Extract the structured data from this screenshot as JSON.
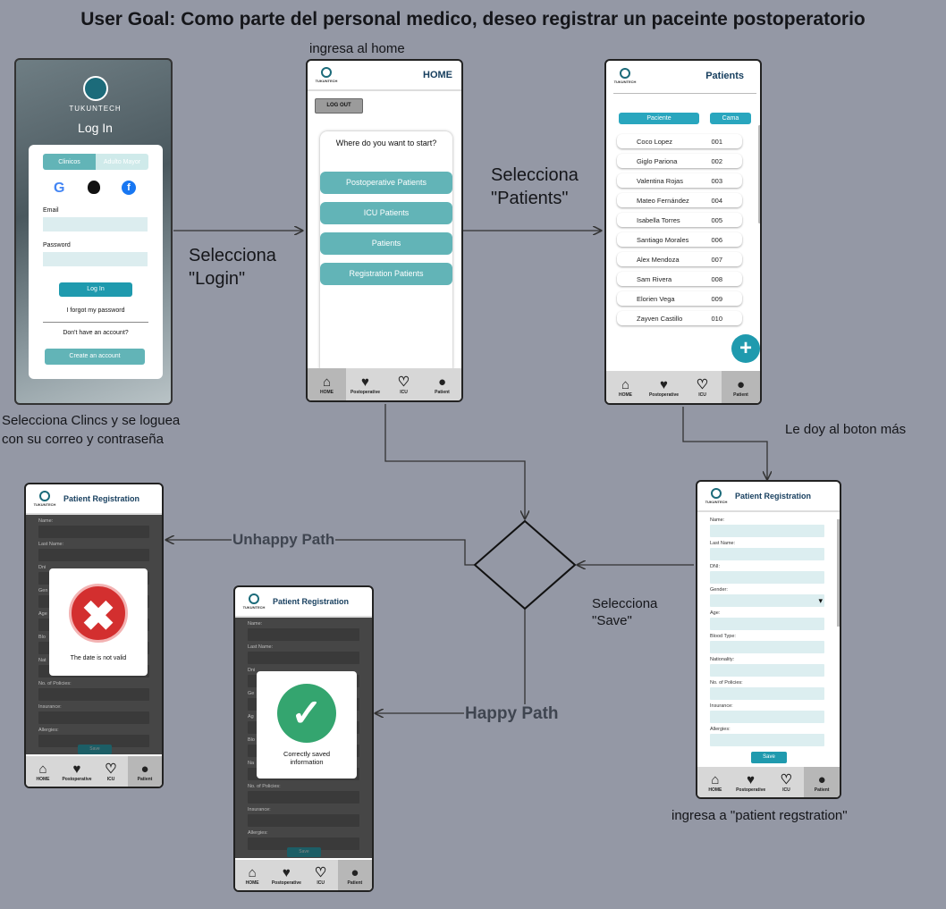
{
  "title": "User Goal: Como parte del personal medico, deseo registrar un paceinte postoperatorio",
  "captions": {
    "home_enter": "ingresa al home",
    "login_step": [
      "Selecciona Clincs y se loguea",
      "con su correo y contraseña"
    ],
    "select_login": [
      "Selecciona",
      "\"Login\""
    ],
    "select_patients": [
      "Selecciona",
      "\"Patients\""
    ],
    "plus_button": "Le doy al boton más",
    "select_save": [
      "Selecciona",
      "\"Save\""
    ],
    "unhappy": "Unhappy Path",
    "happy": "Happy Path",
    "enter_registration": "ingresa a \"patient regstration\""
  },
  "login": {
    "brand": "TUKUNTECH",
    "heading": "Log In",
    "tab_clinics": "Clinicos",
    "tab_elder": "Adulto Mayor",
    "email_label": "Email",
    "password_label": "Password",
    "login_button": "Log In",
    "forgot": "I forgot my password",
    "no_account": "Don't have an account?",
    "create": "Create an account"
  },
  "home": {
    "title": "HOME",
    "brand": "TUKUNTECH",
    "logout": "LOG OUT",
    "prompt": "Where do you want to start?",
    "options": [
      "Postoperative Patients",
      "ICU Patients",
      "Patients",
      "Registration Patients"
    ]
  },
  "patients": {
    "title": "Patients",
    "brand": "TUKUNTECH",
    "col_patient": "Paciente",
    "col_bed": "Cama",
    "rows": [
      [
        "Coco Lopez",
        "001"
      ],
      [
        "Giglo Pariona",
        "002"
      ],
      [
        "Valentina Rojas",
        "003"
      ],
      [
        "Mateo Fernández",
        "004"
      ],
      [
        "Isabella Torres",
        "005"
      ],
      [
        "Santiago Morales",
        "006"
      ],
      [
        "Alex Mendoza",
        "007"
      ],
      [
        "Sam Rivera",
        "008"
      ],
      [
        "Elorien Vega",
        "009"
      ],
      [
        "Zayven Castillo",
        "010"
      ]
    ],
    "add": "+"
  },
  "nav": {
    "home": "HOME",
    "postop": "Postoperative",
    "icu": "ICU",
    "patient": "Patient"
  },
  "registration": {
    "title": "Patient Registration",
    "brand": "TUKUNTECH",
    "fields": [
      "Name:",
      "Last Name:",
      "DNI:",
      "Gender:",
      "Age:",
      "Blood Type:",
      "Nationality:",
      "No. of Policies:",
      "Insurance:",
      "Allergies:"
    ],
    "save": "Save"
  },
  "error": {
    "message": "The date is not valid",
    "left_fields": [
      "Name:",
      "Last Name:",
      "Dni",
      "Gen",
      "Age",
      "Blo",
      "Nat",
      "No. of Policies:",
      "Insurance:",
      "Allergies:"
    ]
  },
  "success": {
    "line1": "Correctly saved",
    "line2": "information",
    "left_fields": [
      "Name:",
      "Last Name:",
      "Dni",
      "Ge",
      "Ag",
      "Blo",
      "Na",
      "No. of Policies:",
      "Insurance:",
      "Allergies:"
    ]
  },
  "colors": {
    "teal": "#62b4b7",
    "background": "#9498a5",
    "error": "#d32f2f",
    "success": "#34a56f"
  }
}
